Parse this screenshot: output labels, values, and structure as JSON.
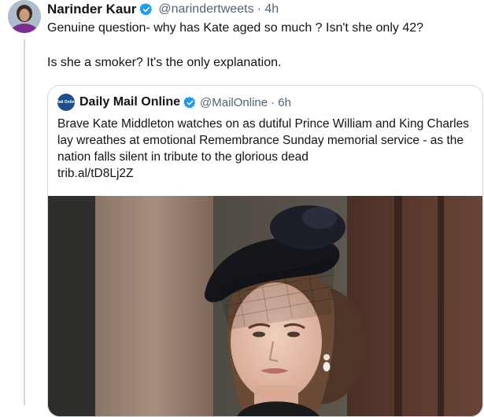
{
  "tweet": {
    "author_name": "Narinder Kaur",
    "author_handle": "@narindertweets",
    "time": "· 4h",
    "verified_icon": "verified-badge-icon",
    "text_line1": "Genuine question- why has Kate aged so much ? Isn't she only 42?",
    "text_line2": "Is she a smoker? It's the only explanation."
  },
  "quoted": {
    "logo_text": "Mail Online",
    "author_name": "Daily Mail Online",
    "author_handle": "@MailOnline",
    "time": "· 6h",
    "verified_icon": "verified-badge-icon",
    "text": "Brave Kate Middleton watches on as dutiful Prince William and King Charles lay wreathes at emotional Remembrance Sunday memorial service - as the nation falls silent in tribute to the glorious dead",
    "link": "trib.al/tD8Lj2Z"
  },
  "colors": {
    "text": "#0f1419",
    "secondary": "#536471",
    "verified": "#1d9bf0",
    "border": "#cfd9de"
  }
}
